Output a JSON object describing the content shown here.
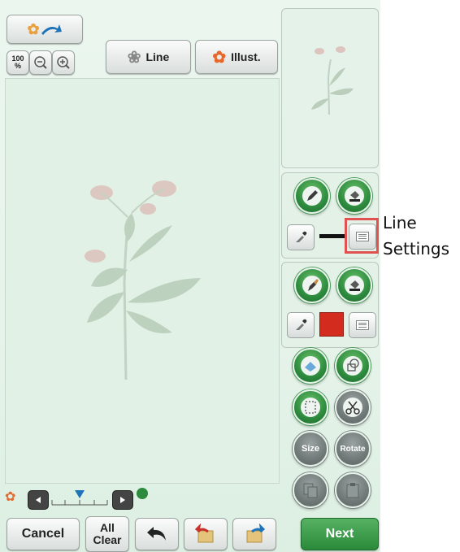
{
  "toolbar": {
    "zoom_level": "100",
    "zoom_unit": "%",
    "line_button": "Line",
    "illust_button": "Illust."
  },
  "right_panel": {
    "line_color": "#111111",
    "region_color": "#d32c1e"
  },
  "round_buttons": {
    "size": "Size",
    "rotate": "Rotate"
  },
  "annotation": {
    "text_line1": "Line",
    "text_line2": "Settings",
    "highlight_color": "#e05252"
  },
  "bottom_bar": {
    "cancel": "Cancel",
    "all_clear_line1": "All",
    "all_clear_line2": "Clear",
    "next": "Next"
  },
  "slider": {
    "level": 0.5
  }
}
